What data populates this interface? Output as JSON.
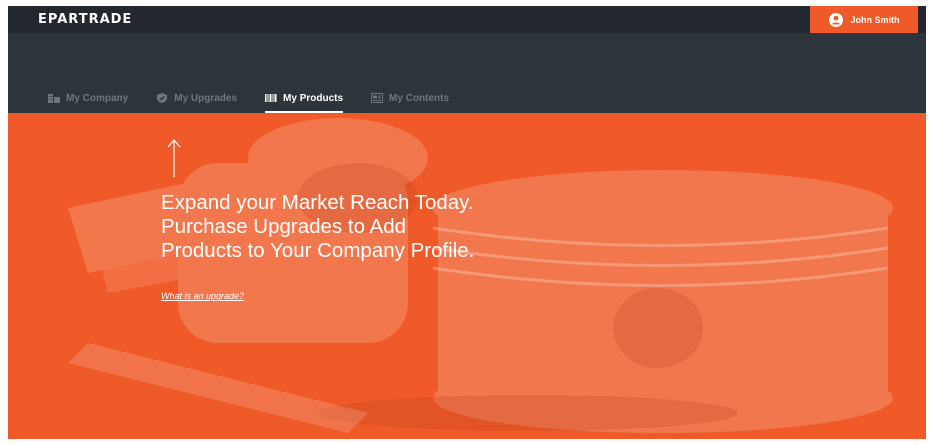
{
  "header": {
    "logo": "EPARTRADE",
    "user_name": "John Smith",
    "user_icon": "user-circle-icon"
  },
  "tabs": [
    {
      "label": "My Company",
      "icon": "building-icon",
      "active": false
    },
    {
      "label": "My Upgrades",
      "icon": "shield-icon",
      "active": false
    },
    {
      "label": "My Products",
      "icon": "barcode-icon",
      "active": true
    },
    {
      "label": "My Contents",
      "icon": "document-icon",
      "active": false
    }
  ],
  "hero": {
    "headline": [
      "Expand your Market Reach Today.",
      "Purchase Upgrades to Add",
      "Products to Your Company Profile."
    ],
    "link_text": "What is an upgrade?",
    "arrow_icon": "arrow-up-icon"
  },
  "colors": {
    "accent": "#f05a28",
    "topbar": "#22282e",
    "nav_bg": "#2d343b",
    "tab_inactive": "#6e767e",
    "tab_active": "#ffffff"
  }
}
